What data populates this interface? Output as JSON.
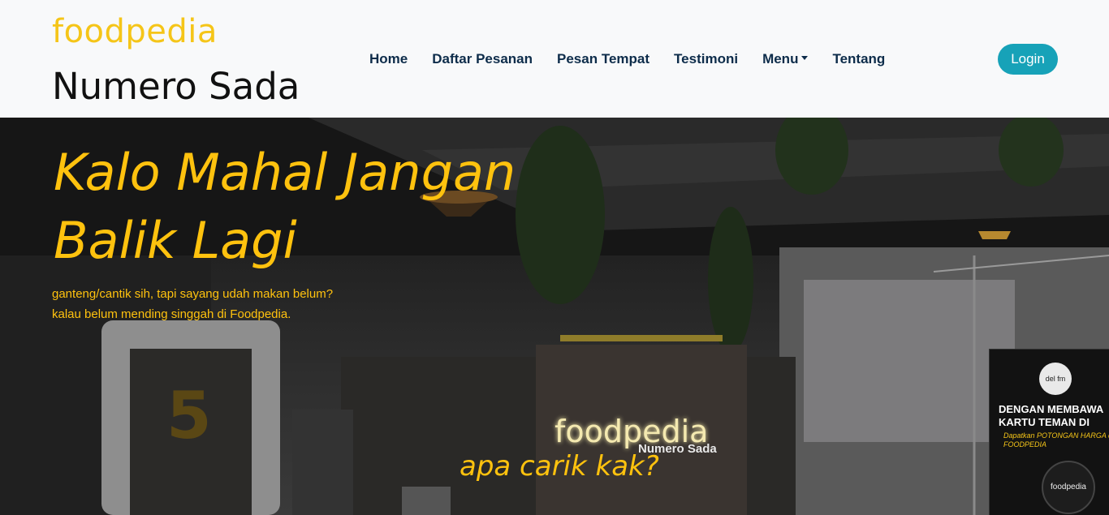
{
  "navbar": {
    "brand_logo": "foodpedia",
    "brand_subtitle": "Numero Sada",
    "items": [
      {
        "label": "Home"
      },
      {
        "label": "Daftar Pesanan"
      },
      {
        "label": "Pesan Tempat"
      },
      {
        "label": "Testimoni"
      },
      {
        "label": "Menu"
      },
      {
        "label": "Tentang"
      }
    ],
    "login_label": "Login"
  },
  "hero": {
    "title": "Kalo Mahal Jangan Balik Lagi",
    "text_line1": "ganteng/cantik sih, tapi sayang udah makan belum?",
    "text_line2": "kalau belum mending singgah di Foodpedia.",
    "question": "apa carik kak?",
    "neon_sign": "foodpedia",
    "neon_sub": "Numero Sada",
    "banner_text": "DENGAN MEMBAWA KARTU TEMAN DI",
    "banner_sub": "Dapatkan POTONGAN HARGA di FOODPEDIA",
    "badge_label": "foodpedia",
    "radio_label": "del fm"
  },
  "colors": {
    "accent": "#ffc20e",
    "brand": "#f5c518",
    "nav_text": "#0d2c4a",
    "login_bg": "#17a2b8"
  }
}
